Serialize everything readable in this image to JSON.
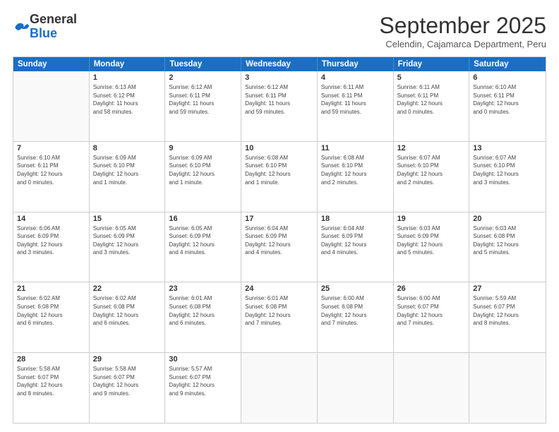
{
  "header": {
    "logo_general": "General",
    "logo_blue": "Blue",
    "title": "September 2025",
    "subtitle": "Celendin, Cajamarca Department, Peru"
  },
  "weekdays": [
    "Sunday",
    "Monday",
    "Tuesday",
    "Wednesday",
    "Thursday",
    "Friday",
    "Saturday"
  ],
  "weeks": [
    [
      {
        "day": "",
        "info": ""
      },
      {
        "day": "1",
        "info": "Sunrise: 6:13 AM\nSunset: 6:12 PM\nDaylight: 11 hours\nand 58 minutes."
      },
      {
        "day": "2",
        "info": "Sunrise: 6:12 AM\nSunset: 6:11 PM\nDaylight: 11 hours\nand 59 minutes."
      },
      {
        "day": "3",
        "info": "Sunrise: 6:12 AM\nSunset: 6:11 PM\nDaylight: 11 hours\nand 59 minutes."
      },
      {
        "day": "4",
        "info": "Sunrise: 6:11 AM\nSunset: 6:11 PM\nDaylight: 11 hours\nand 59 minutes."
      },
      {
        "day": "5",
        "info": "Sunrise: 6:11 AM\nSunset: 6:11 PM\nDaylight: 12 hours\nand 0 minutes."
      },
      {
        "day": "6",
        "info": "Sunrise: 6:10 AM\nSunset: 6:11 PM\nDaylight: 12 hours\nand 0 minutes."
      }
    ],
    [
      {
        "day": "7",
        "info": "Sunrise: 6:10 AM\nSunset: 6:11 PM\nDaylight: 12 hours\nand 0 minutes."
      },
      {
        "day": "8",
        "info": "Sunrise: 6:09 AM\nSunset: 6:10 PM\nDaylight: 12 hours\nand 1 minute."
      },
      {
        "day": "9",
        "info": "Sunrise: 6:09 AM\nSunset: 6:10 PM\nDaylight: 12 hours\nand 1 minute."
      },
      {
        "day": "10",
        "info": "Sunrise: 6:08 AM\nSunset: 6:10 PM\nDaylight: 12 hours\nand 1 minute."
      },
      {
        "day": "11",
        "info": "Sunrise: 6:08 AM\nSunset: 6:10 PM\nDaylight: 12 hours\nand 2 minutes."
      },
      {
        "day": "12",
        "info": "Sunrise: 6:07 AM\nSunset: 6:10 PM\nDaylight: 12 hours\nand 2 minutes."
      },
      {
        "day": "13",
        "info": "Sunrise: 6:07 AM\nSunset: 6:10 PM\nDaylight: 12 hours\nand 3 minutes."
      }
    ],
    [
      {
        "day": "14",
        "info": "Sunrise: 6:06 AM\nSunset: 6:09 PM\nDaylight: 12 hours\nand 3 minutes."
      },
      {
        "day": "15",
        "info": "Sunrise: 6:05 AM\nSunset: 6:09 PM\nDaylight: 12 hours\nand 3 minutes."
      },
      {
        "day": "16",
        "info": "Sunrise: 6:05 AM\nSunset: 6:09 PM\nDaylight: 12 hours\nand 4 minutes."
      },
      {
        "day": "17",
        "info": "Sunrise: 6:04 AM\nSunset: 6:09 PM\nDaylight: 12 hours\nand 4 minutes."
      },
      {
        "day": "18",
        "info": "Sunrise: 6:04 AM\nSunset: 6:09 PM\nDaylight: 12 hours\nand 4 minutes."
      },
      {
        "day": "19",
        "info": "Sunrise: 6:03 AM\nSunset: 6:09 PM\nDaylight: 12 hours\nand 5 minutes."
      },
      {
        "day": "20",
        "info": "Sunrise: 6:03 AM\nSunset: 6:08 PM\nDaylight: 12 hours\nand 5 minutes."
      }
    ],
    [
      {
        "day": "21",
        "info": "Sunrise: 6:02 AM\nSunset: 6:08 PM\nDaylight: 12 hours\nand 6 minutes."
      },
      {
        "day": "22",
        "info": "Sunrise: 6:02 AM\nSunset: 6:08 PM\nDaylight: 12 hours\nand 6 minutes."
      },
      {
        "day": "23",
        "info": "Sunrise: 6:01 AM\nSunset: 6:08 PM\nDaylight: 12 hours\nand 6 minutes."
      },
      {
        "day": "24",
        "info": "Sunrise: 6:01 AM\nSunset: 6:08 PM\nDaylight: 12 hours\nand 7 minutes."
      },
      {
        "day": "25",
        "info": "Sunrise: 6:00 AM\nSunset: 6:08 PM\nDaylight: 12 hours\nand 7 minutes."
      },
      {
        "day": "26",
        "info": "Sunrise: 6:00 AM\nSunset: 6:07 PM\nDaylight: 12 hours\nand 7 minutes."
      },
      {
        "day": "27",
        "info": "Sunrise: 5:59 AM\nSunset: 6:07 PM\nDaylight: 12 hours\nand 8 minutes."
      }
    ],
    [
      {
        "day": "28",
        "info": "Sunrise: 5:58 AM\nSunset: 6:07 PM\nDaylight: 12 hours\nand 8 minutes."
      },
      {
        "day": "29",
        "info": "Sunrise: 5:58 AM\nSunset: 6:07 PM\nDaylight: 12 hours\nand 9 minutes."
      },
      {
        "day": "30",
        "info": "Sunrise: 5:57 AM\nSunset: 6:07 PM\nDaylight: 12 hours\nand 9 minutes."
      },
      {
        "day": "",
        "info": ""
      },
      {
        "day": "",
        "info": ""
      },
      {
        "day": "",
        "info": ""
      },
      {
        "day": "",
        "info": ""
      }
    ]
  ]
}
